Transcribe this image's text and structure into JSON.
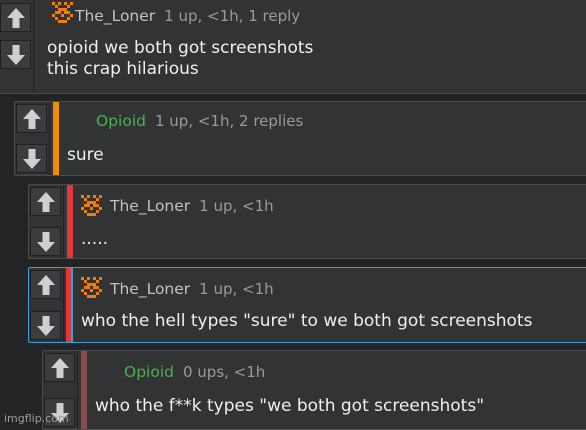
{
  "comments": [
    {
      "user": "The_Loner",
      "meta": "1 up, <1h, 1 reply",
      "text": "opioid we both got screenshots\nthis crap hilarious",
      "bar_color": "",
      "user_color": "#c2c2c2"
    },
    {
      "user": "Opioid",
      "meta": "1 up, <1h, 2 replies",
      "text": "sure",
      "bar_color": "#f08c00",
      "user_color": "#4caf50"
    },
    {
      "user": "The_Loner",
      "meta": "1 up, <1h",
      "text": ".....",
      "bar_color": "#e03a3a",
      "user_color": "#c2c2c2"
    },
    {
      "user": "The_Loner",
      "meta": "1 up, <1h",
      "text": "who the hell types \"sure\" to we both got screenshots",
      "bar_color": "#e03a3a",
      "user_color": "#c2c2c2"
    },
    {
      "user": "Opioid",
      "meta": "0 ups, <1h",
      "text": "who the f**k types \"we both got screenshots\"",
      "bar_color": "#8a4b4b",
      "user_color": "#4caf50"
    }
  ],
  "icons": {
    "upvote": "arrow-up-icon",
    "downvote": "arrow-down-icon",
    "avatar": "pixel-avatar-icon"
  },
  "accent_colors": {
    "highlight_border": "#3aa0d8"
  },
  "watermark": "imgflip.com"
}
